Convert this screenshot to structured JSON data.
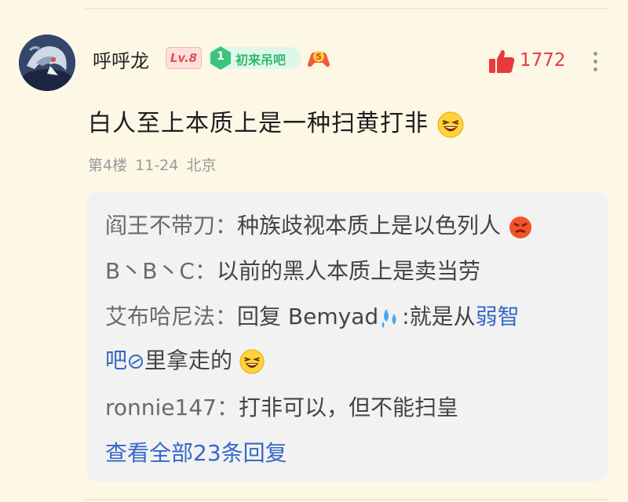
{
  "comment": {
    "username": "呼呼龙",
    "level": "Lv.8",
    "honor_number": "1",
    "honor_title": "初来吊吧",
    "game_badge_num": "5",
    "like_count": "1772",
    "text": "白人至上本质上是一种扫黄打非",
    "floor": "第4楼",
    "date": "11-24",
    "location": "北京"
  },
  "replies": [
    {
      "author": "阎王不带刀：",
      "text": "种族歧视本质上是以色列人"
    },
    {
      "author": "B丶B丶C：",
      "text": "以前的黑人本质上是卖当劳"
    },
    {
      "author": "艾布哈尼法：",
      "prefix": "回复 Bemyad",
      "text": ":就是从",
      "link1": "弱智",
      "link2": "吧",
      "suffix": "里拿走的"
    },
    {
      "author": "ronnie147：",
      "text": "打非可以，但不能扫皇"
    }
  ],
  "view_all": "查看全部23条回复",
  "colors": {
    "background": "#fdf8e6",
    "reply_bg": "#f2f2f2",
    "like": "#e8393d",
    "link": "#3568c6"
  }
}
